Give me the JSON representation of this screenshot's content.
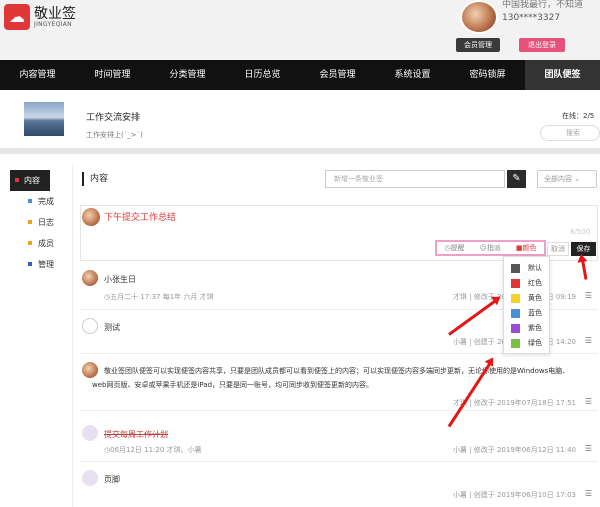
{
  "brand": {
    "title": "敬业签",
    "subtitle": "JINGYEQIAN"
  },
  "user": {
    "message": "中国我最行，不知道",
    "phone": "130****3327",
    "member_btn": "会员管理",
    "logout_btn": "退出登录"
  },
  "nav": [
    "内容管理",
    "时间管理",
    "分类管理",
    "日历总览",
    "会员管理",
    "系统设置",
    "密码锁屏",
    "团队便签"
  ],
  "group": {
    "name": "工作交流安排",
    "desc": "工作安排上(ˊ_>ˋ)",
    "online": "在线：2/5",
    "search_placeholder": "搜索"
  },
  "sidebar": [
    {
      "label": "内容",
      "color": "#e03838"
    },
    {
      "label": "完成",
      "color": "#4a90d9"
    },
    {
      "label": "日志",
      "color": "#f0a020"
    },
    {
      "label": "成员",
      "color": "#f0a020"
    },
    {
      "label": "管理",
      "color": "#3a5fbf"
    }
  ],
  "content": {
    "title": "内容",
    "new_placeholder": "新增一条敬业签",
    "filter": "全部内容"
  },
  "editor": {
    "text": "下午提交工作总结",
    "counter": "8/500",
    "tools": {
      "remind": "提醒",
      "assign": "指派",
      "color": "颜色"
    },
    "cancel": "取消",
    "save": "保存"
  },
  "colors": [
    {
      "label": "默认",
      "hex": "#555555"
    },
    {
      "label": "红色",
      "hex": "#e03838"
    },
    {
      "label": "黄色",
      "hex": "#f2d12a"
    },
    {
      "label": "蓝色",
      "hex": "#4a90d9"
    },
    {
      "label": "紫色",
      "hex": "#9b4dd6"
    },
    {
      "label": "绿色",
      "hex": "#7ac143"
    }
  ],
  "notes": [
    {
      "text": "小张生日",
      "meta": "五月二十 17:37 每1年 六月  才琪",
      "right": "才琪 | 修改于 2019年07月18日 09:19"
    },
    {
      "text": "测试",
      "meta": "",
      "right": "小薯 | 创建于 2019年07月13日 14:20"
    },
    {
      "text": "敬业签团队便签可以实现便签内容共享，只要是团队成员都可以看到便签上的内容；可以实现便签内容多端同步更新，无论你使用的是Windows电脑、",
      "text2": "web网页版、安卓或苹果手机还是iPad，只要是同一账号，均可同步收到便签更新的内容。",
      "meta": "",
      "right": "才琪 | 修改于 2019年07月18日 17:51"
    },
    {
      "text": "提交每周工作计划",
      "meta": "06月12日 11:20  才琪、小薯",
      "right": "小薯 | 修改于 2019年06月12日 11:40"
    },
    {
      "text": "页脚",
      "meta": "",
      "right": "小薯 | 创建于 2019年06月10日 17:03"
    }
  ]
}
